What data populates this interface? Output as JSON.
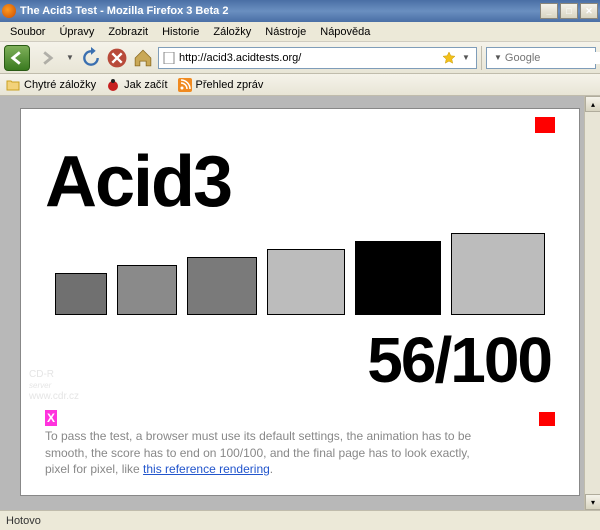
{
  "window": {
    "title": "The Acid3 Test - Mozilla Firefox 3 Beta 2"
  },
  "menu": {
    "file": "Soubor",
    "edit": "Úpravy",
    "view": "Zobrazit",
    "history": "Historie",
    "bookmarks": "Záložky",
    "tools": "Nástroje",
    "help": "Nápověda"
  },
  "url": {
    "value": "http://acid3.acidtests.org/"
  },
  "search": {
    "placeholder": "Google"
  },
  "bookmarks": {
    "smart": "Chytré záložky",
    "start": "Jak začít",
    "news": "Přehled zpráv"
  },
  "acid": {
    "title": "Acid3",
    "score": "56/100",
    "x": "X",
    "instructions_1": "To pass the test, a browser must use its default settings, the animation has to be",
    "instructions_2": "smooth, the score has to end on 100/100, and the final page has to look exactly,",
    "instructions_3": "pixel for pixel, like ",
    "link": "this reference rendering",
    "period": "."
  },
  "watermark": {
    "l1": "CD-R",
    "l2": "server",
    "l3": "www.cdr.cz"
  },
  "status": {
    "text": "Hotovo"
  }
}
